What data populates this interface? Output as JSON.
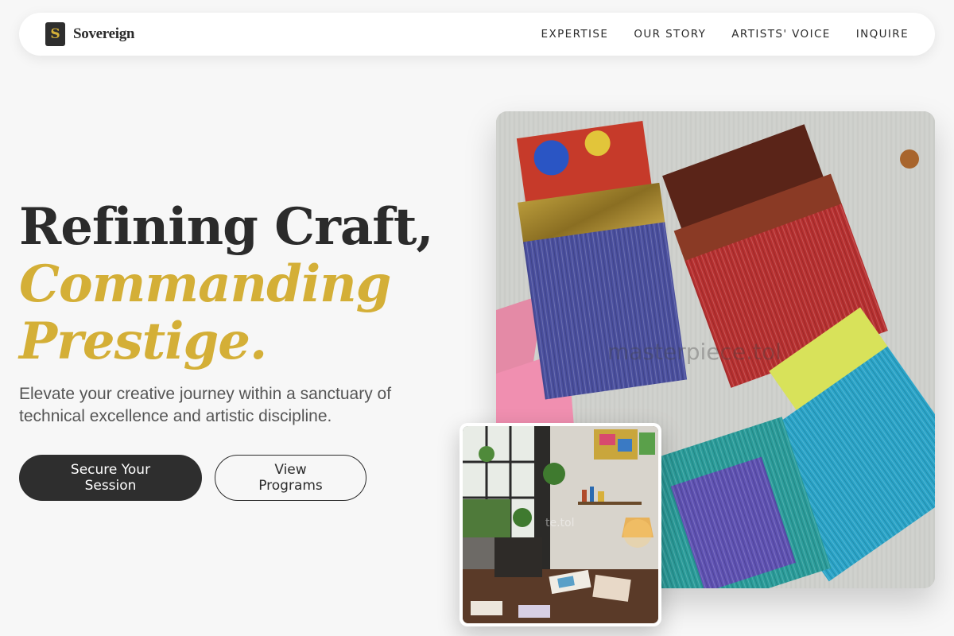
{
  "brand": {
    "mark": "S",
    "name": "Sovereign"
  },
  "nav": {
    "links": [
      {
        "label": "EXPERTISE"
      },
      {
        "label": "OUR STORY"
      },
      {
        "label": "ARTISTS' VOICE"
      },
      {
        "label": "INQUIRE"
      }
    ]
  },
  "hero": {
    "title_line1": "Refining Craft,",
    "title_line2": "Commanding",
    "title_line3": "Prestige.",
    "subtitle": "Elevate your creative journey within a sanctuary of technical excellence and artistic discipline.",
    "primary_cta": "Secure Your Session",
    "secondary_cta": "View Programs"
  },
  "images": {
    "main_watermark": "masterpiece.tol",
    "inset_watermark": "te.tol"
  },
  "colors": {
    "accent": "#d4af37",
    "dark": "#2e2e2e",
    "background": "#f7f7f7"
  },
  "icons": {
    "brand_logo": "s-monogram-icon"
  }
}
